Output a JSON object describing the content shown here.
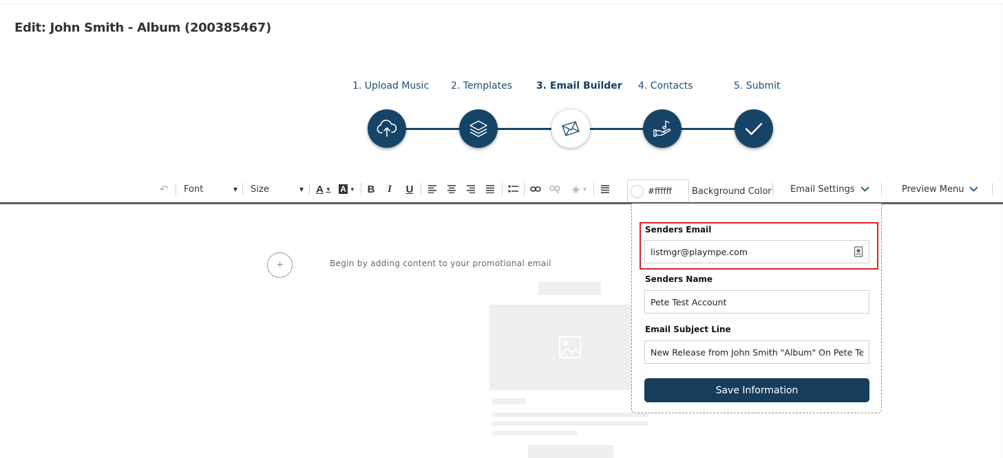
{
  "page": {
    "title": "Edit: John Smith - Album (200385467)"
  },
  "steps": [
    {
      "label": "1. Upload Music",
      "icon": "cloud-upload-icon",
      "active": false
    },
    {
      "label": "2. Templates",
      "icon": "layers-icon",
      "active": false
    },
    {
      "label": "3. Email Builder",
      "icon": "envelope-icon",
      "active": true
    },
    {
      "label": "4. Contacts",
      "icon": "hand-music-note-icon",
      "active": false
    },
    {
      "label": "5. Submit",
      "icon": "checkmark-icon",
      "active": false
    }
  ],
  "toolbar": {
    "font_label": "Font",
    "size_label": "Size",
    "color_value": "#ffffff",
    "background_color_label": "Background Color",
    "email_settings_label": "Email Settings",
    "preview_menu_label": "Preview Menu"
  },
  "canvas": {
    "empty_message": "Begin by adding content to your promotional email",
    "add_symbol": "+"
  },
  "settings_panel": {
    "senders_email_label": "Senders Email",
    "senders_email_value": "listmgr@plaympe.com",
    "senders_name_label": "Senders Name",
    "senders_name_value": "Pete Test Account",
    "subject_label": "Email Subject Line",
    "subject_value": "New Release from John Smith \"Album\" On Pete Test Account",
    "save_label": "Save Information"
  },
  "colors": {
    "brand_navy": "#164466",
    "highlight_red": "#d2222a"
  }
}
